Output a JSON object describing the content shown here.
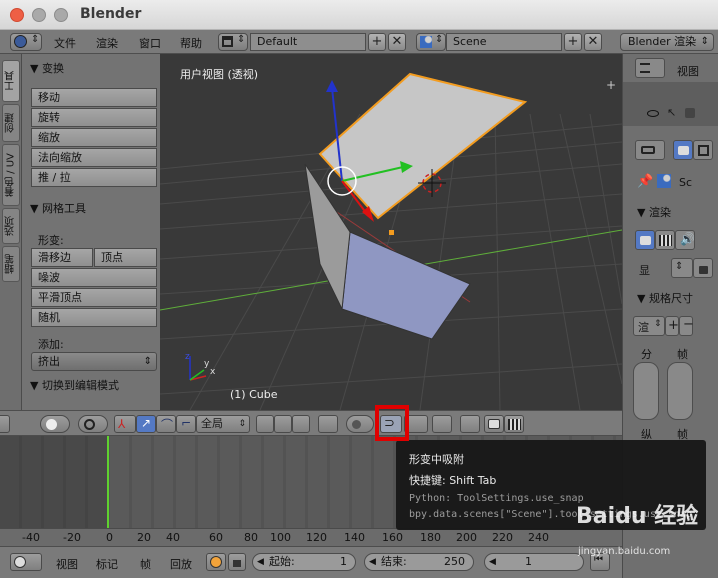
{
  "app": {
    "title": "Blender"
  },
  "menu": {
    "file": "文件",
    "render": "渲染",
    "window": "窗口",
    "help": "帮助"
  },
  "layout_field": "Default",
  "scene_field": "Scene",
  "engine": "Blender 渲染",
  "tabs": [
    "工具",
    "创建",
    "着色 / UV",
    "选项",
    "蜡笔"
  ],
  "transform": {
    "header": "▼ 变换",
    "buttons": [
      "移动",
      "旋转",
      "缩放",
      "法向缩放",
      "推 / 拉"
    ]
  },
  "mesh_tools": {
    "header": "▼ 网格工具",
    "deform_label": "形变:",
    "slide_edge": "滑移边",
    "vertex": "顶点",
    "buttons": [
      "噪波",
      "平滑顶点",
      "随机"
    ],
    "add_label": "添加:",
    "extrude": "挤出"
  },
  "edit_mode": "▼ 切换到编辑模式",
  "viewport": {
    "title": "用户视图 (透视)",
    "object": "(1) Cube"
  },
  "header3d": {
    "orientation": "全局"
  },
  "right": {
    "view": "视图",
    "sc": "Sc",
    "render": "▼ 渲染",
    "show": "显",
    "dimensions": "▼ 规格尺寸",
    "render_short": "渲",
    "split": "分",
    "frame": "帧",
    "vertical": "纵"
  },
  "timeline": {
    "ticks": [
      "-40",
      "-20",
      "0",
      "20",
      "40",
      "60",
      "80",
      "100",
      "120",
      "140",
      "160",
      "180",
      "200",
      "220",
      "240"
    ],
    "view": "视图",
    "marker": "标记",
    "frame": "帧",
    "playback": "回放",
    "start": "起始:",
    "start_val": "1",
    "end": "结束:",
    "end_val": "250",
    "current": "1"
  },
  "tooltip": {
    "title": "形变中吸附",
    "shortcut": "快捷键: Shift Tab",
    "python1": "Python: ToolSettings.use_snap",
    "python2": "bpy.data.scenes[\"Scene\"].tool_settings.use_snap"
  },
  "watermark": {
    "text": "Baidu 经验",
    "url": "jingyan.baidu.com"
  }
}
